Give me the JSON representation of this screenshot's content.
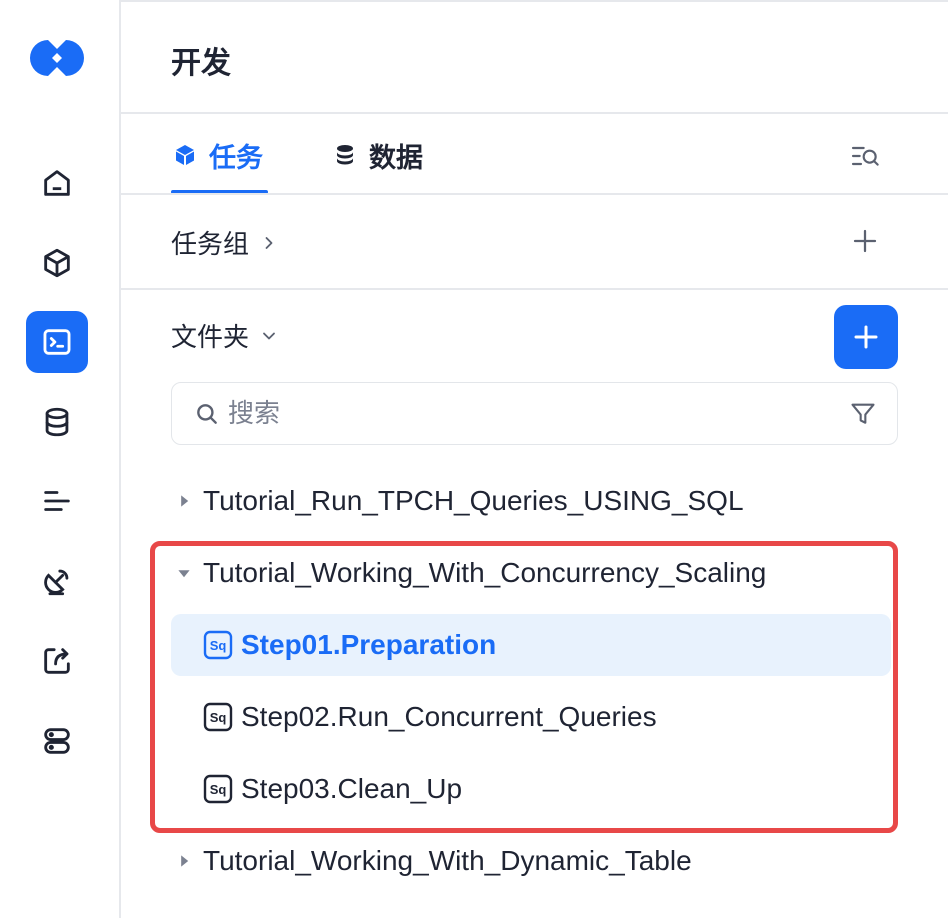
{
  "header": {
    "title": "开发"
  },
  "tabs": [
    {
      "label": "任务",
      "icon": "cube-icon",
      "active": true
    },
    {
      "label": "数据",
      "icon": "database-icon",
      "active": false
    }
  ],
  "task_group": {
    "label": "任务组"
  },
  "folder": {
    "label": "文件夹"
  },
  "search": {
    "placeholder": "搜索"
  },
  "tree": {
    "folder1": "Tutorial_Run_TPCH_Queries_USING_SQL",
    "folder2": "Tutorial_Working_With_Concurrency_Scaling",
    "files": [
      "Step01.Preparation",
      "Step02.Run_Concurrent_Queries",
      "Step03.Clean_Up"
    ],
    "folder3": "Tutorial_Working_With_Dynamic_Table"
  },
  "sidebar_icons": [
    "home-icon",
    "cube-icon",
    "terminal-icon",
    "database-icon",
    "list-icon",
    "satellite-icon",
    "share-icon",
    "server-icon"
  ],
  "colors": {
    "accent": "#1a6cf6",
    "highlight": "#e84848",
    "selected_bg": "#e8f2fd"
  }
}
